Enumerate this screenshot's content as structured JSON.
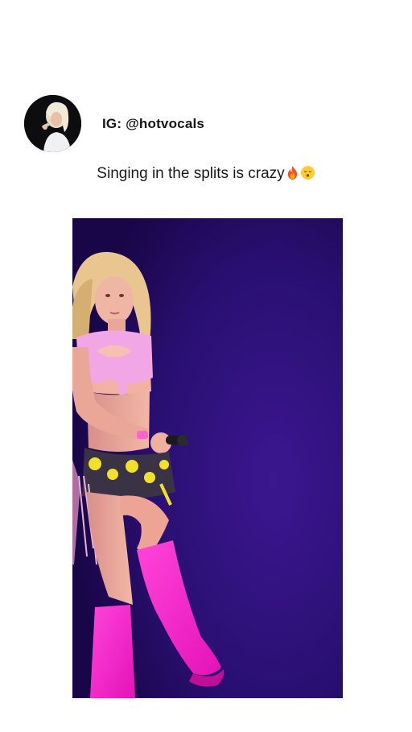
{
  "post": {
    "author_handle": "IG: @hotvocals",
    "caption_text": "Singing in the splits is crazy",
    "caption_emojis": [
      "fire-emoji",
      "face-exhaling-emoji"
    ],
    "media_type": "video-frame"
  },
  "colors": {
    "background": "#ffffff",
    "stage_purple": "#2a0d6e",
    "boots_pink": "#ff2fd0",
    "top_pink": "#f2a6e6",
    "accent_yellow": "#f2e12b"
  }
}
